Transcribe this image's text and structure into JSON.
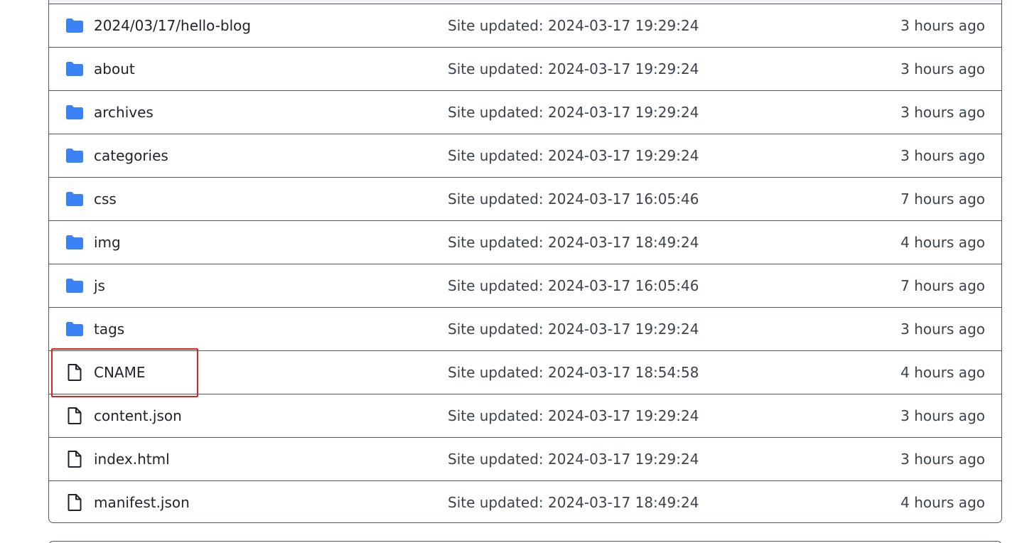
{
  "colors": {
    "folder_icon": "#3b82f6",
    "file_icon": "#1f2328",
    "highlight": "#e0241b",
    "border": "#4f5660"
  },
  "rows": [
    {
      "kind": "folder",
      "icon": "folder-icon",
      "name": "2024/03/17/hello-blog",
      "commit": "Site updated: 2024-03-17 19:29:24",
      "age": "3 hours ago"
    },
    {
      "kind": "folder",
      "icon": "folder-icon",
      "name": "about",
      "commit": "Site updated: 2024-03-17 19:29:24",
      "age": "3 hours ago"
    },
    {
      "kind": "folder",
      "icon": "folder-icon",
      "name": "archives",
      "commit": "Site updated: 2024-03-17 19:29:24",
      "age": "3 hours ago"
    },
    {
      "kind": "folder",
      "icon": "folder-icon",
      "name": "categories",
      "commit": "Site updated: 2024-03-17 19:29:24",
      "age": "3 hours ago"
    },
    {
      "kind": "folder",
      "icon": "folder-icon",
      "name": "css",
      "commit": "Site updated: 2024-03-17 16:05:46",
      "age": "7 hours ago"
    },
    {
      "kind": "folder",
      "icon": "folder-icon",
      "name": "img",
      "commit": "Site updated: 2024-03-17 18:49:24",
      "age": "4 hours ago"
    },
    {
      "kind": "folder",
      "icon": "folder-icon",
      "name": "js",
      "commit": "Site updated: 2024-03-17 16:05:46",
      "age": "7 hours ago"
    },
    {
      "kind": "folder",
      "icon": "folder-icon",
      "name": "tags",
      "commit": "Site updated: 2024-03-17 19:29:24",
      "age": "3 hours ago"
    },
    {
      "kind": "file",
      "icon": "file-icon",
      "name": "CNAME",
      "commit": "Site updated: 2024-03-17 18:54:58",
      "age": "4 hours ago"
    },
    {
      "kind": "file",
      "icon": "file-icon",
      "name": "content.json",
      "commit": "Site updated: 2024-03-17 19:29:24",
      "age": "3 hours ago"
    },
    {
      "kind": "file",
      "icon": "file-icon",
      "name": "index.html",
      "commit": "Site updated: 2024-03-17 19:29:24",
      "age": "3 hours ago"
    },
    {
      "kind": "file",
      "icon": "file-icon",
      "name": "manifest.json",
      "commit": "Site updated: 2024-03-17 18:49:24",
      "age": "4 hours ago"
    }
  ]
}
